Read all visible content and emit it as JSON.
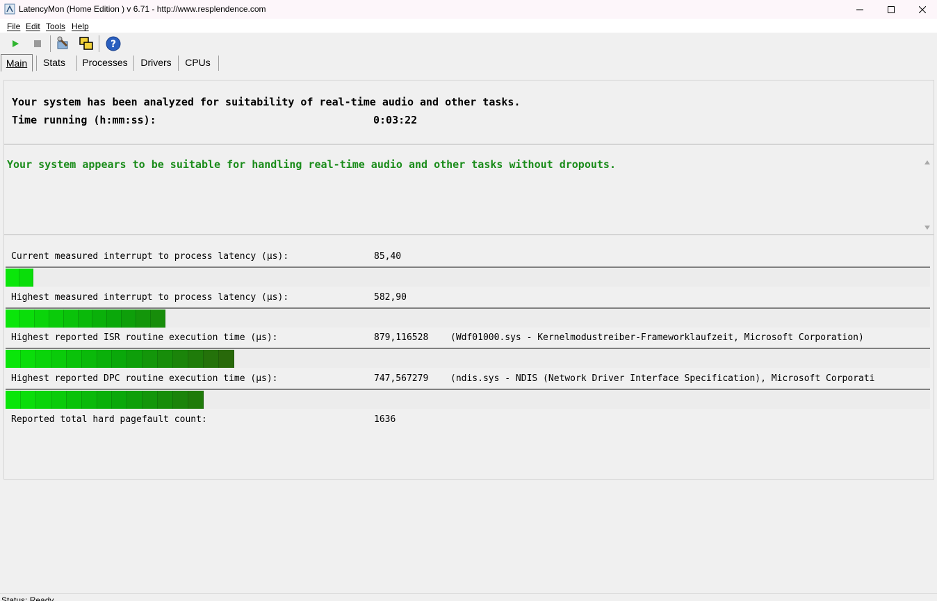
{
  "window": {
    "title": "LatencyMon  (Home Edition )  v 6.71 - http://www.resplendence.com",
    "minimize_icon": "minimize-icon",
    "maximize_icon": "maximize-icon",
    "close_icon": "close-icon"
  },
  "menu": {
    "items": [
      "File",
      "Edit",
      "Tools",
      "Help"
    ]
  },
  "toolbar": {
    "icons": [
      "play-icon",
      "stop-icon",
      "driver-tool-icon",
      "windows-icon",
      "help-icon"
    ]
  },
  "tabs": [
    "Main",
    "Stats",
    "Processes",
    "Drivers",
    "CPUs"
  ],
  "summary": {
    "analyzed_text": "Your system has been analyzed for suitability of real-time audio and other tasks.",
    "time_label": "Time running (h:mm:ss):",
    "time_value": "0:03:22"
  },
  "verdict": {
    "text": "Your system appears to be suitable for handling real-time audio and other tasks without dropouts.",
    "color": "#1a8c1a"
  },
  "metrics": [
    {
      "label": "Current measured interrupt to process latency (µs):",
      "value": "85,40",
      "extra": "",
      "bar_level": 0.03
    },
    {
      "label": "Highest measured interrupt to process latency (µs):",
      "value": "582,90",
      "extra": "",
      "bar_level": 0.173
    },
    {
      "label": "Highest reported ISR routine execution time (µs):",
      "value": "879,116528",
      "extra": "(Wdf01000.sys - Kernelmodustreiber-Frameworklaufzeit, Microsoft Corporation)",
      "bar_level": 0.247
    },
    {
      "label": "Highest reported DPC routine execution time (µs):",
      "value": "747,567279",
      "extra": "(ndis.sys - NDIS (Network Driver Interface Specification), Microsoft Corporati",
      "bar_level": 0.214
    },
    {
      "label": "Reported total hard pagefault count:",
      "value": "1636",
      "extra": ""
    }
  ],
  "status": {
    "text": "Status: Ready"
  }
}
